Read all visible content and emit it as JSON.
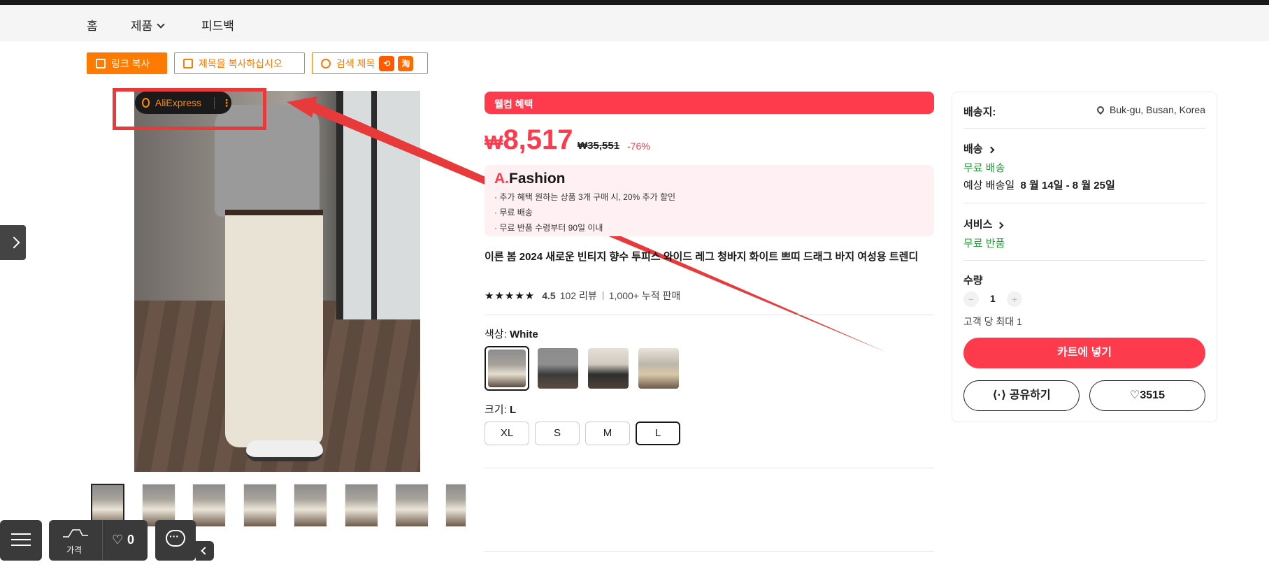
{
  "nav": {
    "home": "홈",
    "products": "제품",
    "feedback": "피드백"
  },
  "toolbar": {
    "copy_link": "링크 복사",
    "copy_title": "제목을 복사하십시오",
    "search_title": "검색 제목",
    "taobao": "淘"
  },
  "image_overlay": {
    "search_label": "AliExpress",
    "more_label": "⋮"
  },
  "product": {
    "welcome": "웰컴 혜택",
    "currency": "₩",
    "price": "8,517",
    "old_price": "₩35,551",
    "discount": "-76%",
    "brand_prefix": "A.",
    "brand_name": "Fashion",
    "promo_lines": [
      "· 추가 혜택 원하는 상품 3개 구매 시, 20% 추가 할인",
      "· 무료 배송",
      "· 무료 반품  수령부터 90일 이내"
    ],
    "title": "이른 봄 2024 새로운 빈티지 향수 투피스 와이드 레그 청바지 화이트 쁘띠 드래그 바지 여성용 트렌디",
    "stars": "★★★★★",
    "rating": "4.5",
    "reviews": "102 리뷰",
    "sold": "1,000+ 누적 판매",
    "color_label": "색상: ",
    "color_value": "White",
    "size_label": "크기: ",
    "size_value": "L",
    "sizes": [
      "XL",
      "S",
      "M",
      "L"
    ]
  },
  "panel": {
    "ship_to_label": "배송지:",
    "ship_to_value": "Buk-gu, Busan, Korea",
    "delivery_label": "배송",
    "free_shipping": "무료 배송",
    "eta_prefix": "예상 배송일",
    "eta_value": "8 월 14일 - 8 월 25일",
    "service_label": "서비스",
    "free_return": "무료 반품",
    "qty_label": "수량",
    "qty_minus": "−",
    "qty_value": "1",
    "qty_plus": "+",
    "qty_limit": "고객 당 최대 1",
    "add_to_cart": "카트에 넣기",
    "share": "공유하기",
    "wishlist_count": "3515"
  },
  "floating": {
    "price_label": "가격",
    "heart_count": "0"
  }
}
